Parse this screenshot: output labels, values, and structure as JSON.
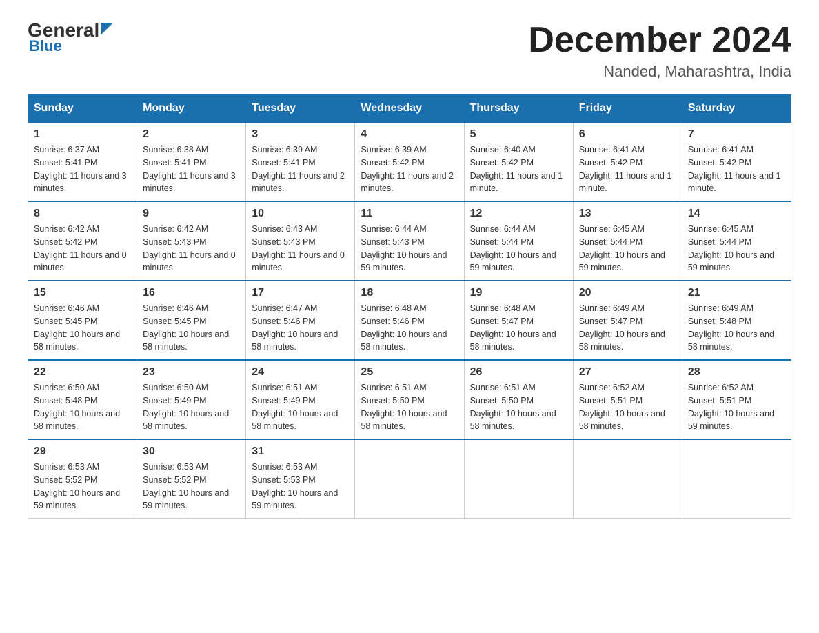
{
  "header": {
    "logo_top": "General",
    "logo_bottom": "Blue",
    "month_title": "December 2024",
    "location": "Nanded, Maharashtra, India"
  },
  "days_of_week": [
    "Sunday",
    "Monday",
    "Tuesday",
    "Wednesday",
    "Thursday",
    "Friday",
    "Saturday"
  ],
  "weeks": [
    [
      {
        "day": "1",
        "sunrise": "6:37 AM",
        "sunset": "5:41 PM",
        "daylight": "11 hours and 3 minutes."
      },
      {
        "day": "2",
        "sunrise": "6:38 AM",
        "sunset": "5:41 PM",
        "daylight": "11 hours and 3 minutes."
      },
      {
        "day": "3",
        "sunrise": "6:39 AM",
        "sunset": "5:41 PM",
        "daylight": "11 hours and 2 minutes."
      },
      {
        "day": "4",
        "sunrise": "6:39 AM",
        "sunset": "5:42 PM",
        "daylight": "11 hours and 2 minutes."
      },
      {
        "day": "5",
        "sunrise": "6:40 AM",
        "sunset": "5:42 PM",
        "daylight": "11 hours and 1 minute."
      },
      {
        "day": "6",
        "sunrise": "6:41 AM",
        "sunset": "5:42 PM",
        "daylight": "11 hours and 1 minute."
      },
      {
        "day": "7",
        "sunrise": "6:41 AM",
        "sunset": "5:42 PM",
        "daylight": "11 hours and 1 minute."
      }
    ],
    [
      {
        "day": "8",
        "sunrise": "6:42 AM",
        "sunset": "5:42 PM",
        "daylight": "11 hours and 0 minutes."
      },
      {
        "day": "9",
        "sunrise": "6:42 AM",
        "sunset": "5:43 PM",
        "daylight": "11 hours and 0 minutes."
      },
      {
        "day": "10",
        "sunrise": "6:43 AM",
        "sunset": "5:43 PM",
        "daylight": "11 hours and 0 minutes."
      },
      {
        "day": "11",
        "sunrise": "6:44 AM",
        "sunset": "5:43 PM",
        "daylight": "10 hours and 59 minutes."
      },
      {
        "day": "12",
        "sunrise": "6:44 AM",
        "sunset": "5:44 PM",
        "daylight": "10 hours and 59 minutes."
      },
      {
        "day": "13",
        "sunrise": "6:45 AM",
        "sunset": "5:44 PM",
        "daylight": "10 hours and 59 minutes."
      },
      {
        "day": "14",
        "sunrise": "6:45 AM",
        "sunset": "5:44 PM",
        "daylight": "10 hours and 59 minutes."
      }
    ],
    [
      {
        "day": "15",
        "sunrise": "6:46 AM",
        "sunset": "5:45 PM",
        "daylight": "10 hours and 58 minutes."
      },
      {
        "day": "16",
        "sunrise": "6:46 AM",
        "sunset": "5:45 PM",
        "daylight": "10 hours and 58 minutes."
      },
      {
        "day": "17",
        "sunrise": "6:47 AM",
        "sunset": "5:46 PM",
        "daylight": "10 hours and 58 minutes."
      },
      {
        "day": "18",
        "sunrise": "6:48 AM",
        "sunset": "5:46 PM",
        "daylight": "10 hours and 58 minutes."
      },
      {
        "day": "19",
        "sunrise": "6:48 AM",
        "sunset": "5:47 PM",
        "daylight": "10 hours and 58 minutes."
      },
      {
        "day": "20",
        "sunrise": "6:49 AM",
        "sunset": "5:47 PM",
        "daylight": "10 hours and 58 minutes."
      },
      {
        "day": "21",
        "sunrise": "6:49 AM",
        "sunset": "5:48 PM",
        "daylight": "10 hours and 58 minutes."
      }
    ],
    [
      {
        "day": "22",
        "sunrise": "6:50 AM",
        "sunset": "5:48 PM",
        "daylight": "10 hours and 58 minutes."
      },
      {
        "day": "23",
        "sunrise": "6:50 AM",
        "sunset": "5:49 PM",
        "daylight": "10 hours and 58 minutes."
      },
      {
        "day": "24",
        "sunrise": "6:51 AM",
        "sunset": "5:49 PM",
        "daylight": "10 hours and 58 minutes."
      },
      {
        "day": "25",
        "sunrise": "6:51 AM",
        "sunset": "5:50 PM",
        "daylight": "10 hours and 58 minutes."
      },
      {
        "day": "26",
        "sunrise": "6:51 AM",
        "sunset": "5:50 PM",
        "daylight": "10 hours and 58 minutes."
      },
      {
        "day": "27",
        "sunrise": "6:52 AM",
        "sunset": "5:51 PM",
        "daylight": "10 hours and 58 minutes."
      },
      {
        "day": "28",
        "sunrise": "6:52 AM",
        "sunset": "5:51 PM",
        "daylight": "10 hours and 59 minutes."
      }
    ],
    [
      {
        "day": "29",
        "sunrise": "6:53 AM",
        "sunset": "5:52 PM",
        "daylight": "10 hours and 59 minutes."
      },
      {
        "day": "30",
        "sunrise": "6:53 AM",
        "sunset": "5:52 PM",
        "daylight": "10 hours and 59 minutes."
      },
      {
        "day": "31",
        "sunrise": "6:53 AM",
        "sunset": "5:53 PM",
        "daylight": "10 hours and 59 minutes."
      },
      null,
      null,
      null,
      null
    ]
  ]
}
